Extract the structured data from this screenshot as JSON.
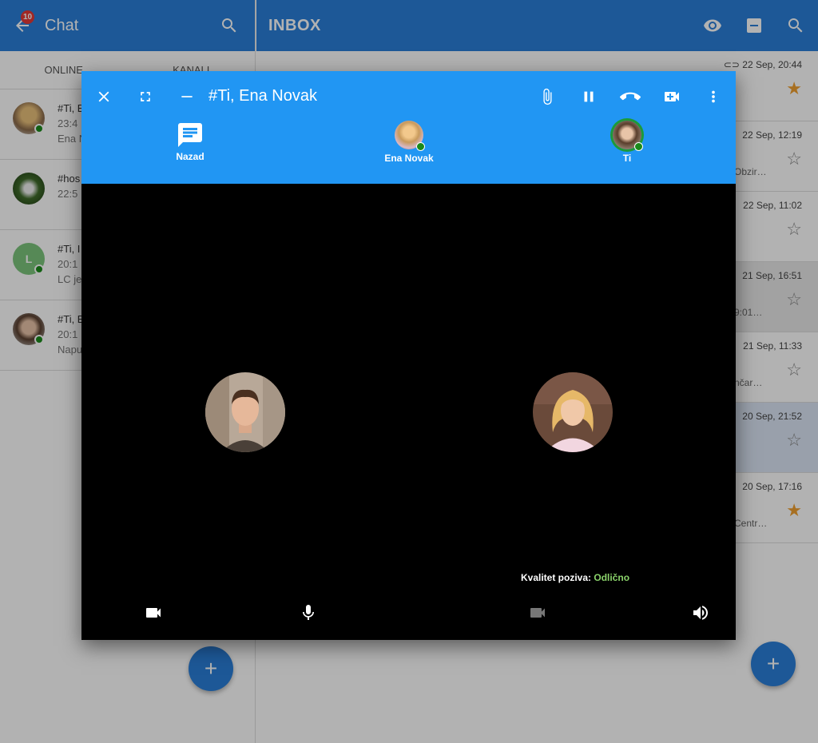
{
  "chat_pane": {
    "title": "Chat",
    "badge": "10",
    "tabs": [
      "ONLINE",
      "KANALI"
    ],
    "conversations": [
      {
        "line1": "#Ti, E",
        "line2": "23:4",
        "line3": "Ena N"
      },
      {
        "line1": "#hos",
        "line2": "22:5",
        "line3": ""
      },
      {
        "line1": "#Ti, I",
        "line2": "20:1",
        "line3": "LC je",
        "avatar_letter": "L"
      },
      {
        "line1": "#Ti, E",
        "line2": "20:1",
        "line3": "Napu"
      }
    ],
    "fab_label": "+"
  },
  "inbox_pane": {
    "title": "INBOX",
    "messages": [
      {
        "date": "22 Sep, 20:44",
        "snippet": "",
        "starred": true,
        "attachment": true
      },
      {
        "date": "22 Sep, 12:19",
        "snippet": "Obzir…",
        "starred": false
      },
      {
        "date": "22 Sep, 11:02",
        "snippet": "",
        "starred": false
      },
      {
        "date": "21 Sep, 16:51",
        "snippet": "9:01…",
        "starred": false
      },
      {
        "date": "21 Sep, 11:33",
        "snippet": "nčar…",
        "starred": false
      },
      {
        "date": "20 Sep, 21:52",
        "snippet": "",
        "starred": false
      },
      {
        "date": "20 Sep, 17:16",
        "snippet": "Centr…",
        "starred": true
      }
    ],
    "fab_label": "+"
  },
  "dialog": {
    "title": "#Ti, Ena Novak",
    "participants": [
      {
        "label": "Nazad",
        "type": "chat-icon"
      },
      {
        "label": "Ena Novak",
        "type": "avatar"
      },
      {
        "label": "Ti",
        "type": "avatar"
      }
    ],
    "quality_label": "Kvalitet poziva:",
    "quality_value": "Odlično"
  },
  "colors": {
    "app_bar": "#2a7fd8",
    "dialog_header": "#2196f3",
    "online": "#1b8a1b",
    "star": "#f0a030",
    "quality_good": "#8bd36b"
  }
}
